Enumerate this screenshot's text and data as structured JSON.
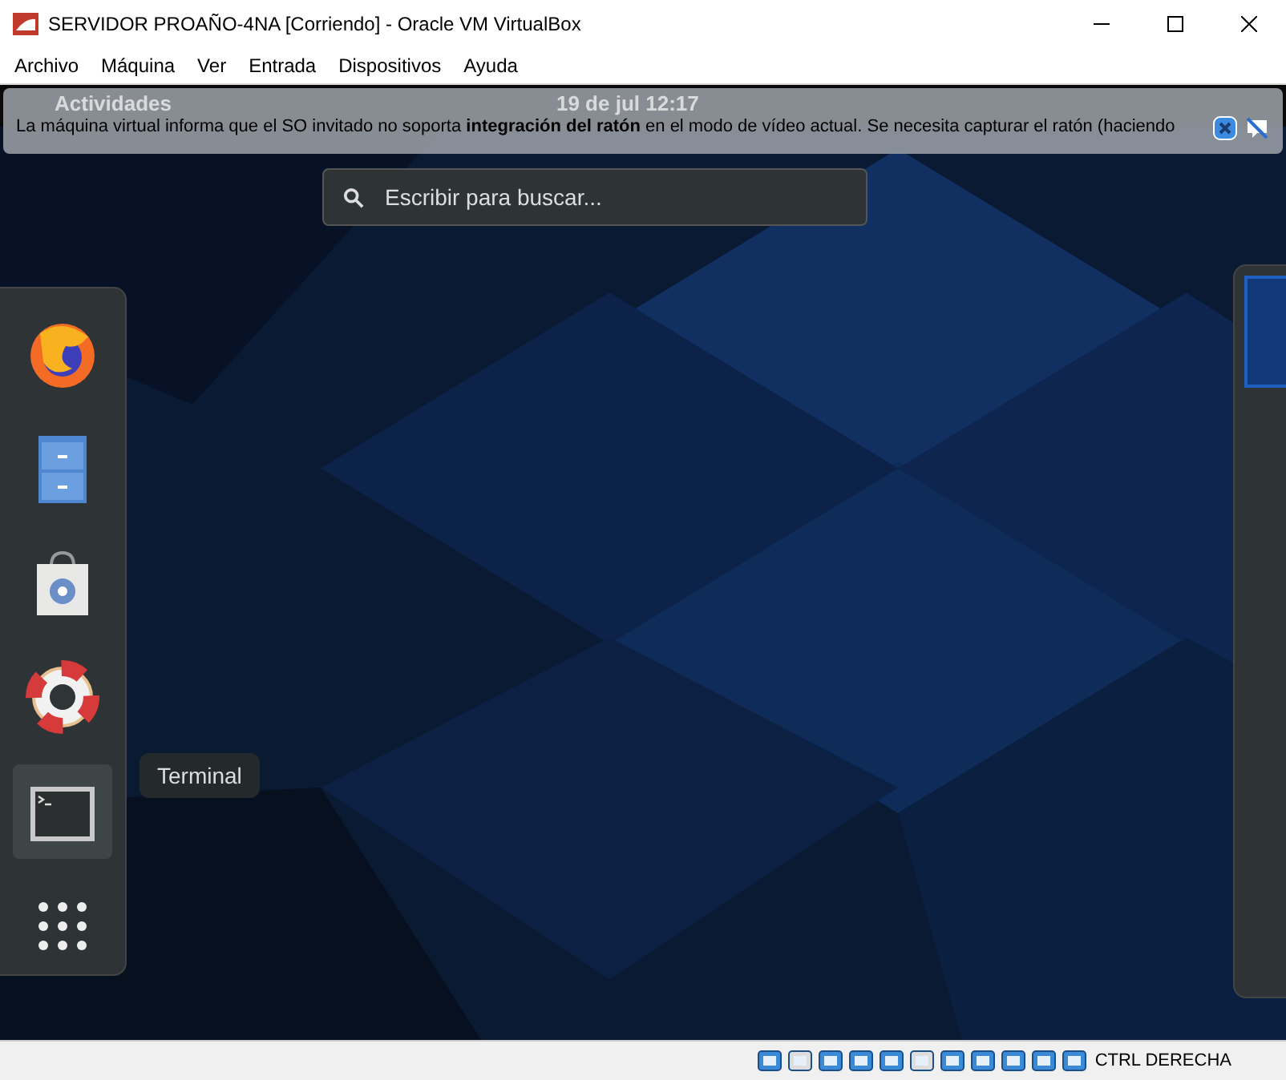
{
  "window": {
    "title": "SERVIDOR PROAÑO-4NA [Corriendo] - Oracle VM VirtualBox"
  },
  "menu": [
    "Archivo",
    "Máquina",
    "Ver",
    "Entrada",
    "Dispositivos",
    "Ayuda"
  ],
  "top_bar": {
    "activities": "Actividades",
    "clock": "19 de jul  12:17"
  },
  "notification": {
    "message": "La máquina virtual informa que el SO invitado no soporta **integración del ratón** en el modo de vídeo actual. Se necesita capturar el ratón (haciendo"
  },
  "search": {
    "placeholder": "Escribir para buscar..."
  },
  "dock": [
    {
      "kind": "firefox",
      "selected": false
    },
    {
      "kind": "files",
      "selected": false
    },
    {
      "kind": "software",
      "selected": false
    },
    {
      "kind": "help",
      "selected": false
    },
    {
      "kind": "terminal",
      "selected": true
    },
    {
      "kind": "apps",
      "selected": false
    }
  ],
  "tooltip": "Terminal",
  "status_bar": {
    "host_key": "CTRL DERECHA"
  }
}
